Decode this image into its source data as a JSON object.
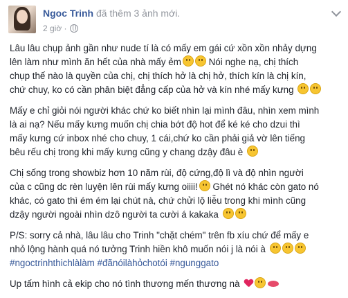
{
  "post": {
    "author": "Ngoc Trinh",
    "action": "đã thêm 3 ảnh mới.",
    "time": "2 giờ ·",
    "paragraphs": [
      {
        "lines": [
          "Lâu lâu chụp ảnh gần như nude tí là có mấy em gái cứ xồn xồn nhảy dựng",
          "lên làm như mình ăn hết của nhà mấy ẻm",
          "Nói nghe nạ, chị thích",
          "chụp thế nào là quyền của chị, chị thích hở là chị hở, thích kín là chị kín,",
          "chứ chuy, ko có cần phân biệt đẳng cấp của hở và kín nhé mấy kưng"
        ]
      },
      {
        "lines": [
          "Mấy e chỉ giỏi nói người khác chứ ko biết nhìn lại mình đâu, nhìn xem mình",
          "là ai nạ? Nếu mấy kưng muốn chị chia bớt độ hot để ké ké cho dzui thì",
          "mấy kưng cứ inbox nhé cho chuy, 1 cái,chứ ko cần phải giả vờ lên tiếng",
          "bêu rếu chị trong khi mấy kưng cũng y chang dzậy đâu è"
        ]
      },
      {
        "lines": [
          "Chị sống trong showbiz hơn 10 năm rùi, độ cứng,độ lì và độ nhìn người",
          "của c cũng dc rèn luyện lên rùi mấy kưng oiiii!",
          "Ghét nó khác còn gato nó",
          "khác, có gato thì ém ém lại chút nà, chứ chửi lộ liễu trong khi mình cũng",
          "dzậy người ngoài nhìn dzô người ta cười á kakaka"
        ]
      },
      {
        "lines": [
          "P/S: sorry cả nhà, lâu lâu cho Trinh \"chặt chém\" trên fb xíu chứ để mấy e",
          "nhỏ lộng hành quá nó tưởng Trinh hiền khô muốn nói j là nói à"
        ],
        "hashtags": "#ngoctrinhthichlàlàm #đãnóilàhỏchotói #ngunggato"
      },
      {
        "lines": [
          "Up tấm hình cả ekip cho nó tình thương mến thương nà"
        ]
      }
    ]
  },
  "icons": {
    "avatar": "avatar",
    "options": "chevron-down-icon",
    "audience": "globe-icon"
  },
  "colors": {
    "author": "#365899",
    "meta": "#90949c",
    "text": "#1d2129",
    "hashtag": "#365899"
  }
}
